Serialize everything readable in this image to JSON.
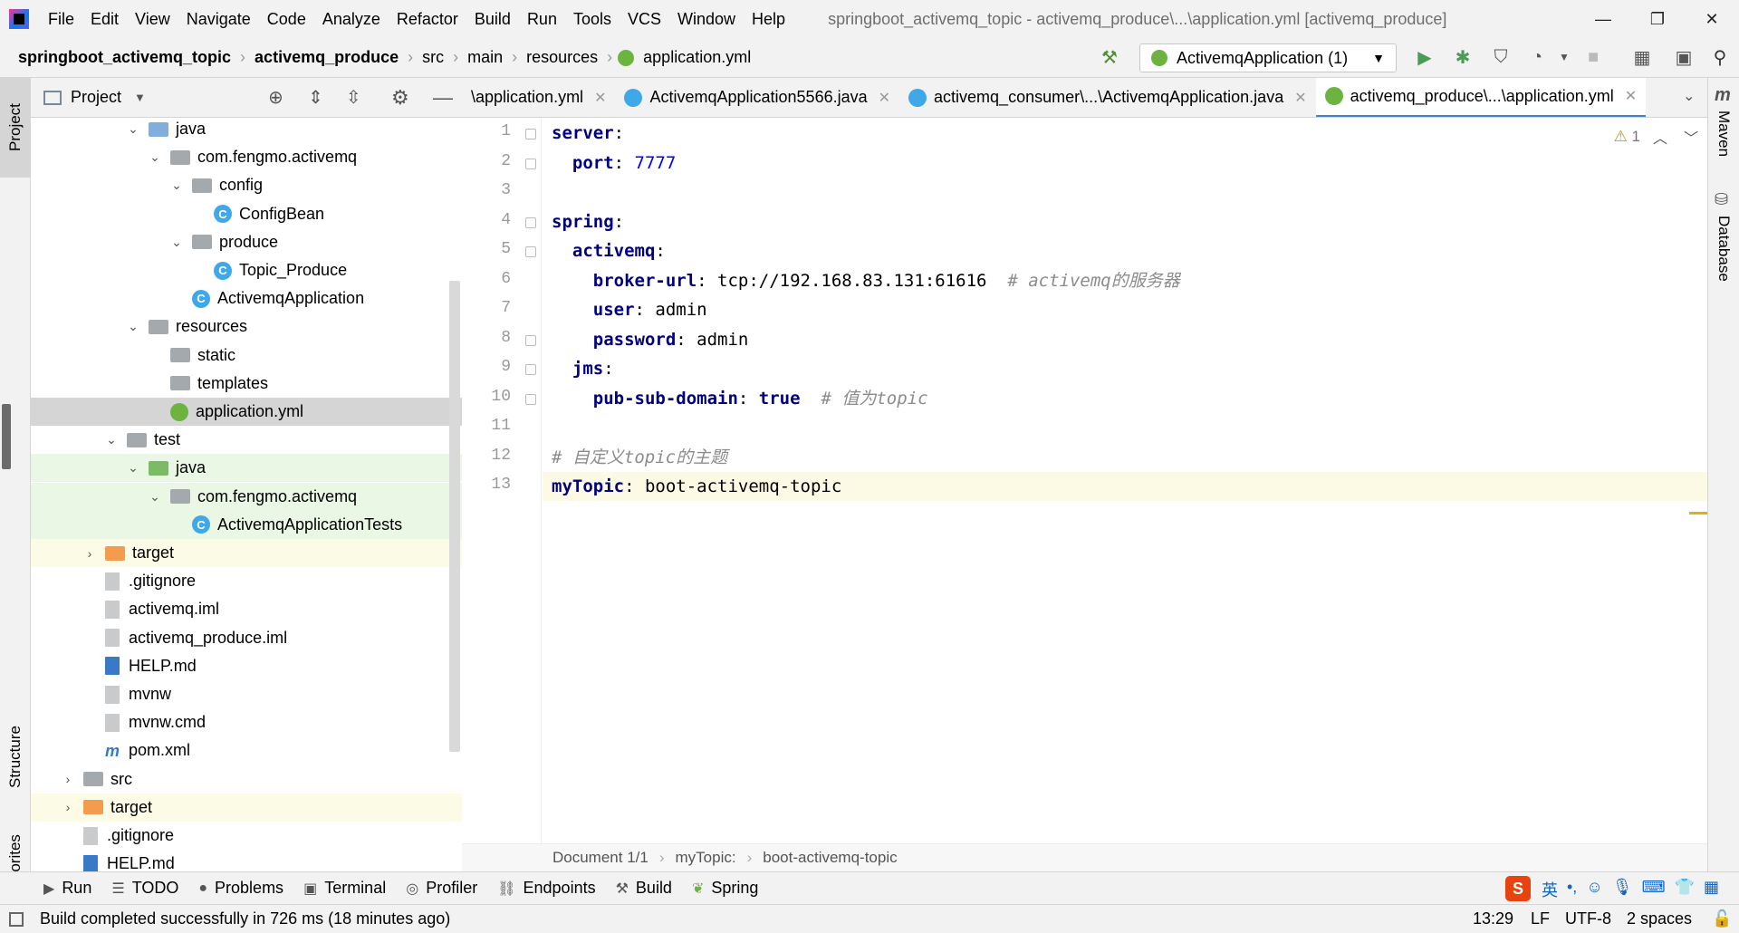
{
  "menubar": {
    "items": [
      "File",
      "Edit",
      "View",
      "Navigate",
      "Code",
      "Analyze",
      "Refactor",
      "Build",
      "Run",
      "Tools",
      "VCS",
      "Window",
      "Help"
    ],
    "title": "springboot_activemq_topic - activemq_produce\\...\\application.yml [activemq_produce]"
  },
  "breadcrumbs": [
    "springboot_activemq_topic",
    "activemq_produce",
    "src",
    "main",
    "resources",
    "application.yml"
  ],
  "run_config": "ActivemqApplication (1)",
  "project_panel": {
    "title": "Project"
  },
  "tree": [
    {
      "label": "java",
      "indent": 5,
      "arrow": "down",
      "icon": "folder-blue"
    },
    {
      "label": "com.fengmo.activemq",
      "indent": 6,
      "arrow": "down",
      "icon": "package"
    },
    {
      "label": "config",
      "indent": 7,
      "arrow": "down",
      "icon": "package"
    },
    {
      "label": "ConfigBean",
      "indent": 8,
      "arrow": "",
      "icon": "class"
    },
    {
      "label": "produce",
      "indent": 7,
      "arrow": "down",
      "icon": "package"
    },
    {
      "label": "Topic_Produce",
      "indent": 8,
      "arrow": "",
      "icon": "class"
    },
    {
      "label": "ActivemqApplication",
      "indent": 7,
      "arrow": "",
      "icon": "spring-class"
    },
    {
      "label": "resources",
      "indent": 5,
      "arrow": "down",
      "icon": "resources"
    },
    {
      "label": "static",
      "indent": 6,
      "arrow": "",
      "icon": "folder-gray"
    },
    {
      "label": "templates",
      "indent": 6,
      "arrow": "",
      "icon": "folder-gray"
    },
    {
      "label": "application.yml",
      "indent": 6,
      "arrow": "",
      "icon": "spring",
      "state": "sel"
    },
    {
      "label": "test",
      "indent": 4,
      "arrow": "down",
      "icon": "folder-gray"
    },
    {
      "label": "java",
      "indent": 5,
      "arrow": "down",
      "icon": "folder-green",
      "state": "green"
    },
    {
      "label": "com.fengmo.activemq",
      "indent": 6,
      "arrow": "down",
      "icon": "package",
      "state": "green"
    },
    {
      "label": "ActivemqApplicationTests",
      "indent": 7,
      "arrow": "",
      "icon": "spring-class",
      "state": "green"
    },
    {
      "label": "target",
      "indent": 3,
      "arrow": "right",
      "icon": "folder-orange",
      "state": "yellow"
    },
    {
      "label": ".gitignore",
      "indent": 3,
      "arrow": "",
      "icon": "file"
    },
    {
      "label": "activemq.iml",
      "indent": 3,
      "arrow": "",
      "icon": "file"
    },
    {
      "label": "activemq_produce.iml",
      "indent": 3,
      "arrow": "",
      "icon": "file"
    },
    {
      "label": "HELP.md",
      "indent": 3,
      "arrow": "",
      "icon": "md"
    },
    {
      "label": "mvnw",
      "indent": 3,
      "arrow": "",
      "icon": "file"
    },
    {
      "label": "mvnw.cmd",
      "indent": 3,
      "arrow": "",
      "icon": "file"
    },
    {
      "label": "pom.xml",
      "indent": 3,
      "arrow": "",
      "icon": "maven"
    },
    {
      "label": "src",
      "indent": 2,
      "arrow": "right",
      "icon": "folder-gray"
    },
    {
      "label": "target",
      "indent": 2,
      "arrow": "right",
      "icon": "folder-orange",
      "state": "yellow"
    },
    {
      "label": ".gitignore",
      "indent": 2,
      "arrow": "",
      "icon": "file"
    },
    {
      "label": "HELP.md",
      "indent": 2,
      "arrow": "",
      "icon": "md"
    }
  ],
  "tabs": [
    {
      "label": "\\application.yml",
      "icon": "spring",
      "active": false
    },
    {
      "label": "ActivemqApplication5566.java",
      "icon": "spring-class",
      "active": false
    },
    {
      "label": "activemq_consumer\\...\\ActivemqApplication.java",
      "icon": "spring-class",
      "active": false
    },
    {
      "label": "activemq_produce\\...\\application.yml",
      "icon": "spring",
      "active": true
    }
  ],
  "editor": {
    "lines": [
      [
        {
          "t": "server",
          "c": "k"
        },
        {
          "t": ":",
          "c": "v"
        }
      ],
      [
        {
          "t": "  port",
          "c": "k"
        },
        {
          "t": ": ",
          "c": "v"
        },
        {
          "t": "7777",
          "c": "num"
        }
      ],
      [],
      [
        {
          "t": "spring",
          "c": "k"
        },
        {
          "t": ":",
          "c": "v"
        }
      ],
      [
        {
          "t": "  activemq",
          "c": "k"
        },
        {
          "t": ":",
          "c": "v"
        }
      ],
      [
        {
          "t": "    broker-url",
          "c": "k"
        },
        {
          "t": ": tcp://192.168.83.131:61616  ",
          "c": "v"
        },
        {
          "t": "# activemq的服务器",
          "c": "cm"
        }
      ],
      [
        {
          "t": "    user",
          "c": "k"
        },
        {
          "t": ": admin",
          "c": "v"
        }
      ],
      [
        {
          "t": "    password",
          "c": "k"
        },
        {
          "t": ": admin",
          "c": "v"
        }
      ],
      [
        {
          "t": "  jms",
          "c": "k"
        },
        {
          "t": ":",
          "c": "v"
        }
      ],
      [
        {
          "t": "    pub-sub-domain",
          "c": "k"
        },
        {
          "t": ": ",
          "c": "v"
        },
        {
          "t": "true",
          "c": "kw"
        },
        {
          "t": "  # 值为topic",
          "c": "cm"
        }
      ],
      [],
      [
        {
          "t": "# 自定义topic的主题",
          "c": "cm"
        }
      ],
      [
        {
          "t": "myTopic",
          "c": "k"
        },
        {
          "t": ": boot-activemq-topic",
          "c": "v"
        }
      ]
    ],
    "warning_count": "1"
  },
  "editor_breadcrumb": [
    "Document 1/1",
    "myTopic:",
    "boot-activemq-topic"
  ],
  "left_tabs": {
    "project": "Project",
    "structure": "Structure",
    "favorites": "Favorites"
  },
  "right_tabs": {
    "maven": "Maven",
    "database": "Database"
  },
  "bottom_tools": [
    "Run",
    "TODO",
    "Problems",
    "Terminal",
    "Profiler",
    "Endpoints",
    "Build",
    "Spring"
  ],
  "status": {
    "message": "Build completed successfully in 726 ms (18 minutes ago)",
    "position": "13:29",
    "line_sep": "LF",
    "encoding": "UTF-8",
    "indent": "2 spaces"
  },
  "ime": {
    "lang": "英"
  }
}
